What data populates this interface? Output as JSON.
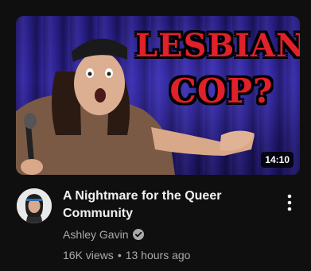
{
  "video": {
    "overlay_line1": "LESBIAN",
    "overlay_line2": "COP?",
    "duration": "14:10",
    "title": "A Nightmare for the Queer Community",
    "channel": "Ashley Gavin",
    "verified": true,
    "views": "16K views",
    "separator": "•",
    "age": "13 hours ago"
  },
  "icons": {
    "verified": "verified-check-icon",
    "menu": "more-vert-icon",
    "mic": "microphone-icon"
  },
  "colors": {
    "background": "#0f0f0f",
    "title": "#f1f1f1",
    "secondary": "#aaaaaa",
    "overlay_text": "#e0202a",
    "curtain": "#3a2fa8"
  }
}
